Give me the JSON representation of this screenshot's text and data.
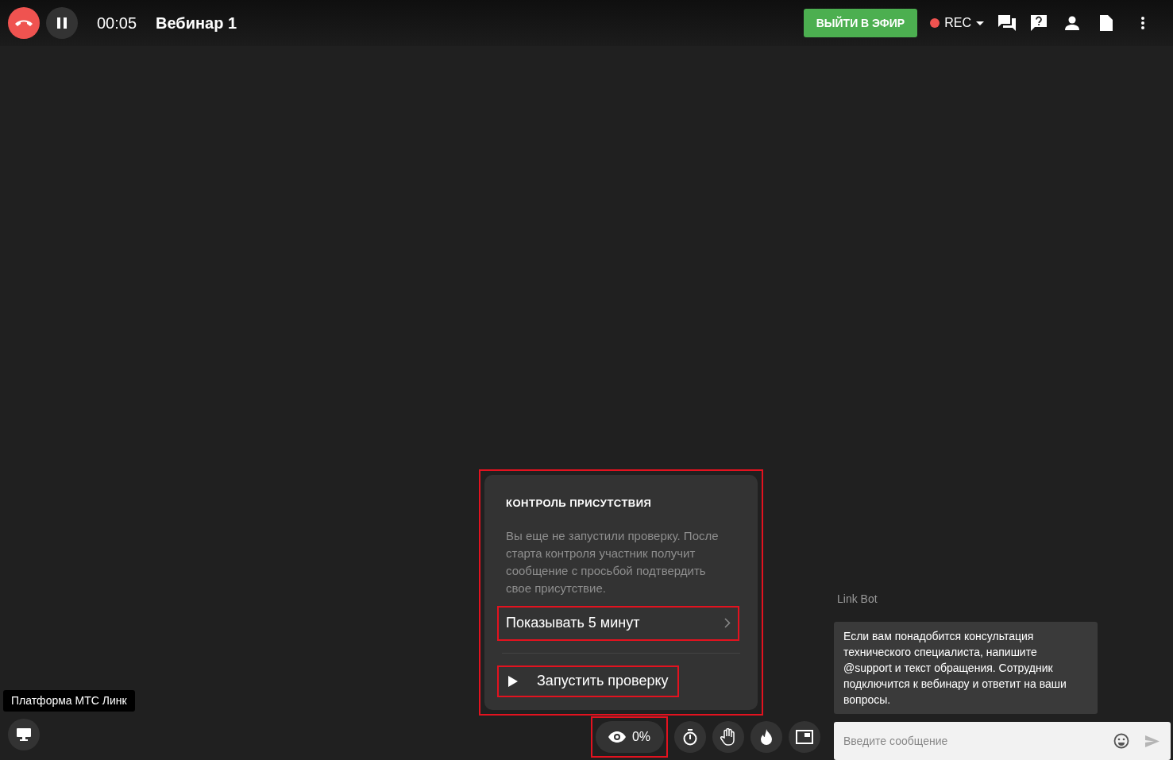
{
  "header": {
    "timer": "00:05",
    "title": "Вебинар 1",
    "go_live_button": "ВЫЙТИ В ЭФИР",
    "rec_label": "REC"
  },
  "attendance_popup": {
    "title": "КОНТРОЛЬ ПРИСУТСТВИЯ",
    "description": "Вы еще не запустили проверку. После старта контроля участник получит сообщение с просьбой подтвердить свое присутствие.",
    "duration_option": "Показывать 5 минут",
    "start_button": "Запустить проверку"
  },
  "toolbar": {
    "attendance_value": "0%"
  },
  "tooltip": "Платформа МТС Линк",
  "chat": {
    "sender": "Link Bot",
    "message": "Если вам понадобится консультация технического специалиста, напишите @support и текст обращения. Сотрудник подключится к вебинару и ответит на ваши вопросы.",
    "input": {
      "placeholder": "Введите сообщение"
    }
  }
}
